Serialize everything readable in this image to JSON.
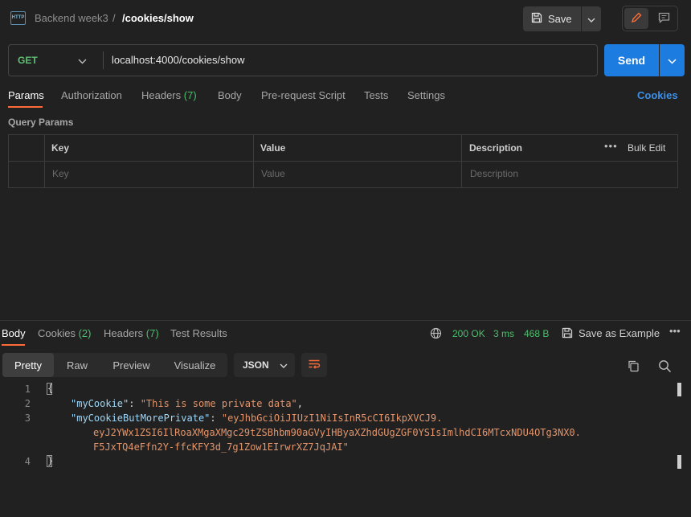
{
  "header": {
    "http_icon_text": "HTTP",
    "collection": "Backend week3",
    "separator": "/",
    "request_name": "/cookies/show",
    "save_label": "Save"
  },
  "request": {
    "method": "GET",
    "url": "localhost:4000/cookies/show",
    "send_label": "Send"
  },
  "request_tabs": {
    "params": "Params",
    "authorization": "Authorization",
    "headers": "Headers",
    "headers_count": "(7)",
    "body": "Body",
    "prerequest": "Pre-request Script",
    "tests": "Tests",
    "settings": "Settings",
    "cookies_link": "Cookies"
  },
  "query_params": {
    "label": "Query Params",
    "columns": [
      "Key",
      "Value",
      "Description"
    ],
    "placeholders": [
      "Key",
      "Value",
      "Description"
    ],
    "more": "•••",
    "bulk_edit": "Bulk Edit"
  },
  "response": {
    "tabs": {
      "body": "Body",
      "cookies": "Cookies",
      "cookies_count": "(2)",
      "headers": "Headers",
      "headers_count": "(7)",
      "test_results": "Test Results"
    },
    "status": "200 OK",
    "time": "3 ms",
    "size": "468 B",
    "save_example": "Save as Example",
    "more": "•••",
    "views": [
      "Pretty",
      "Raw",
      "Preview",
      "Visualize"
    ],
    "format": "JSON",
    "code": {
      "line_numbers": [
        "1",
        "2",
        "3",
        "4"
      ],
      "open_brace": "{",
      "close_brace": "}",
      "key1": "\"myCookie\"",
      "val1": "\"This is some private data\"",
      "key2": "\"myCookieButMorePrivate\"",
      "val2_line1": "\"eyJhbGciOiJIUzI1NiIsInR5cCI6IkpXVCJ9.",
      "val2_line2": "eyJ2YWx1ZSI6IlRoaXMgaXMgc29tZSBhbm90aGVyIHByaXZhdGUgZGF0YSIsImlhdCI6MTcxNDU4OTg3NX0.",
      "val2_line3": "F5JxTQ4eFfn2Y-ffcKFY3d_7g1Zow1EIrwrXZ7JqJAI\"",
      "colon": ": ",
      "comma": ","
    }
  },
  "colors": {
    "accent": "#ff6c37",
    "send": "#1c7ce0",
    "success": "#4bbf6b",
    "json_key": "#9cd7fb",
    "json_string": "#e4956b"
  }
}
